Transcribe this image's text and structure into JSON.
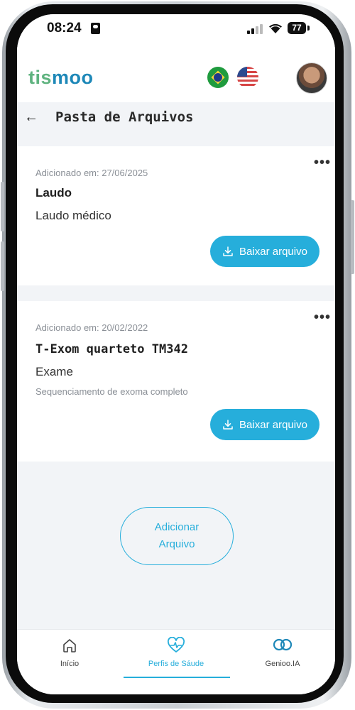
{
  "status_bar": {
    "time": "08:24",
    "battery": "77"
  },
  "header": {
    "logo_prefix": "tis",
    "logo_mid": "moo"
  },
  "title_bar": {
    "title": "Pasta de Arquivos"
  },
  "files": [
    {
      "added": "Adicionado em: 27/06/2025",
      "name": "Laudo",
      "type": "Laudo médico",
      "description": "",
      "download_label": "Baixar arquivo"
    },
    {
      "added": "Adicionado em: 20/02/2022",
      "name": "T-Exom quarteto TM342",
      "type": "Exame",
      "description": "Sequenciamento de exoma completo",
      "download_label": "Baixar arquivo"
    }
  ],
  "add_file": {
    "line1": "Adicionar",
    "line2": "Arquivo"
  },
  "bottom_nav": [
    {
      "label": "Início",
      "icon": "home-icon",
      "active": false
    },
    {
      "label": "Perfis de Sáude",
      "icon": "heart-pulse-icon",
      "active": true
    },
    {
      "label": "Genioo.IA",
      "icon": "infinity-icon",
      "active": false
    }
  ],
  "colors": {
    "accent": "#26aedb",
    "logo_green": "#5fb37f",
    "background": "#f2f4f7"
  }
}
